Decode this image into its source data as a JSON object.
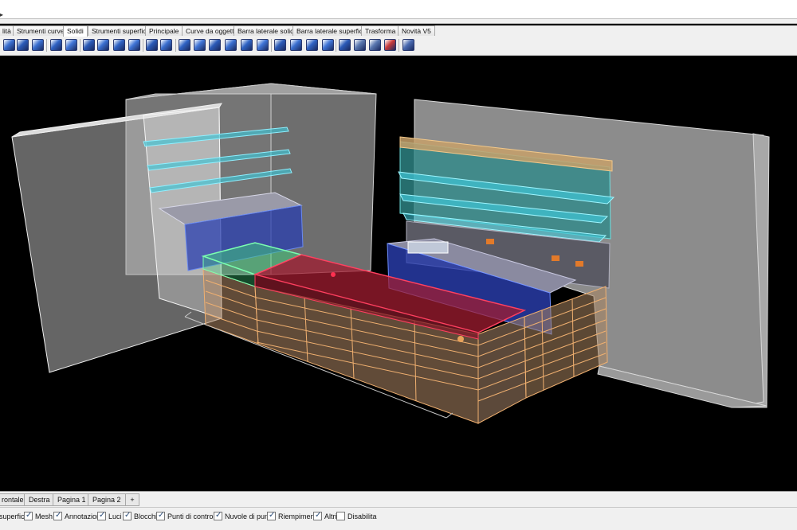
{
  "command_area": {
    "prompt_symbol": "▸"
  },
  "toolbar_tabs": [
    {
      "label": "lità",
      "active": false
    },
    {
      "label": "Strumenti curve",
      "active": false
    },
    {
      "label": "Solidi",
      "active": true
    },
    {
      "label": "Strumenti superfici",
      "active": false
    },
    {
      "label": "Principale",
      "active": false
    },
    {
      "label": "Curve da oggetti",
      "active": false
    },
    {
      "label": "Barra laterale solidi",
      "active": false
    },
    {
      "label": "Barra laterale superfici",
      "active": false
    },
    {
      "label": "Trasforma",
      "active": false
    },
    {
      "label": "Novità V5",
      "active": false
    }
  ],
  "toolbar_icons": [
    {
      "name": "solid-box-icon",
      "color": "#3a6fd0"
    },
    {
      "name": "solid-sphere-icon",
      "color": "#2b5bb8"
    },
    {
      "name": "solid-cylinder-icon",
      "color": "#3a6fd0"
    },
    {
      "name": "solid-cone-icon",
      "color": "#2f63c4"
    },
    {
      "name": "extrude-icon",
      "color": "#3f74d6"
    },
    {
      "name": "boolean-union-icon",
      "color": "#2b5bb8"
    },
    {
      "name": "boolean-difference-icon",
      "color": "#3a6fd0"
    },
    {
      "name": "boolean-intersection-icon",
      "color": "#2f63c4"
    },
    {
      "name": "fillet-edge-icon",
      "color": "#3f74d6"
    },
    {
      "name": "chamfer-edge-icon",
      "color": "#2b5bb8"
    },
    {
      "name": "shell-icon",
      "color": "#3a6fd0"
    },
    {
      "name": "cap-holes-icon",
      "color": "#2f63c4"
    },
    {
      "name": "extract-surface-icon",
      "color": "#3f74d6"
    },
    {
      "name": "move-face-icon",
      "color": "#2b5bb8"
    },
    {
      "name": "move-edge-icon",
      "color": "#3a6fd0"
    },
    {
      "name": "split-face-icon",
      "color": "#2f63c4"
    },
    {
      "name": "fold-face-icon",
      "color": "#3f74d6"
    },
    {
      "name": "solid-edit-icon",
      "color": "#2b5bb8"
    },
    {
      "name": "solid-pipe-icon",
      "color": "#3a6fd0"
    },
    {
      "name": "solid-offset-icon",
      "color": "#2f63c4"
    },
    {
      "name": "wire-cut-icon",
      "color": "#3f74d6"
    },
    {
      "name": "text-solid-icon",
      "color": "#2b5bb8"
    },
    {
      "name": "grid-mesh-icon",
      "color": "#5a78b0"
    },
    {
      "name": "grid-mesh-alt-icon",
      "color": "#5a78b0"
    },
    {
      "name": "delete-face-icon",
      "color": "#c83a3a"
    },
    {
      "name": "solid-cube-yellow-icon",
      "color": "#d8b23a"
    },
    {
      "name": "settings-gear-icon",
      "color": "#4a6ab0"
    }
  ],
  "view_tabs": [
    {
      "label": "rontale"
    },
    {
      "label": "Destra"
    },
    {
      "label": "Pagina 1"
    },
    {
      "label": "Pagina 2"
    },
    {
      "label": "+"
    }
  ],
  "filters": [
    {
      "label": "superfici",
      "checked": true,
      "show_box": false
    },
    {
      "label": "Mesh",
      "checked": true,
      "show_box": true
    },
    {
      "label": "Annotazioni",
      "checked": true,
      "show_box": true
    },
    {
      "label": "Luci",
      "checked": true,
      "show_box": true
    },
    {
      "label": "Blocchi",
      "checked": true,
      "show_box": true
    },
    {
      "label": "Punti di controllo",
      "checked": true,
      "show_box": true
    },
    {
      "label": "Nuvole di punti",
      "checked": true,
      "show_box": true
    },
    {
      "label": "Riempimenti",
      "checked": true,
      "show_box": true
    },
    {
      "label": "Altri",
      "checked": true,
      "show_box": true
    },
    {
      "label": "Disabilita",
      "checked": false,
      "show_box": true
    }
  ],
  "colors": {
    "viewport_bg": "#000000",
    "wall_gray": "#8c8c8c",
    "shelf_cyan": "#3ec4d6",
    "counter_red": "#c0243c",
    "counter_green": "#3cd07a",
    "counter_orange": "#e8a25a",
    "cabinet_blue": "#2a3fb0"
  }
}
